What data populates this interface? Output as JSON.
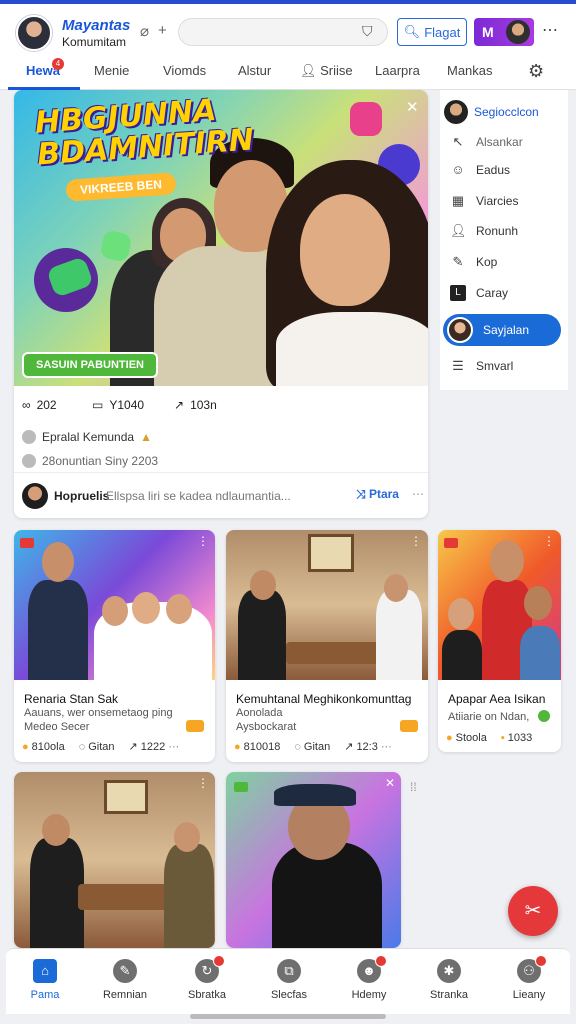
{
  "header": {
    "brand_title": "Mayantas",
    "brand_subtitle": "Komumitam",
    "search_placeholder": "",
    "flag_label": "Flagat",
    "m_label": "M"
  },
  "tabs": [
    {
      "label": "Hewa",
      "active": true,
      "badge": "4"
    },
    {
      "label": "Menie"
    },
    {
      "label": "Viomds"
    },
    {
      "label": "Alstur"
    },
    {
      "label": "Sriise"
    },
    {
      "label": "Laarpra"
    },
    {
      "label": "Mankas"
    }
  ],
  "hero": {
    "title_line1": "HBGJUNNA",
    "title_line2": "BDAMNITIRN",
    "subtitle": "VIKREEB BEN",
    "pill": "SASUIN PABUNTIEN",
    "stats": {
      "likes": "202",
      "comments": "Y1040",
      "shares": "103n"
    },
    "meta_title": "Epralal Kemunda",
    "meta_sub": "28onuntian Siny 2203",
    "footer_name": "Hopruelis",
    "footer_text": "Ellspsa liri se kadea ndlaumantia...",
    "footer_share": "Ptara"
  },
  "sidebar": {
    "header": "Segiocclcon",
    "items": [
      {
        "label": "Alsankar",
        "icon": "back-arrow-icon"
      },
      {
        "label": "Eadus",
        "icon": "smiley-icon"
      },
      {
        "label": "Viarcies",
        "icon": "calendar-icon"
      },
      {
        "label": "Ronunh",
        "icon": "person-icon"
      },
      {
        "label": "Kop",
        "icon": "edit-icon"
      },
      {
        "label": "Caray",
        "icon": "l-square-icon"
      },
      {
        "label": "Sayjalan",
        "icon": "avatar",
        "active": true
      },
      {
        "label": "Smvarl",
        "icon": "menu-icon"
      }
    ]
  },
  "cards": [
    {
      "title": "Renaria Stan Sak",
      "desc1": "Aauans, wer onsemetaog ping",
      "desc2": "Medeo Secer",
      "stat1": "810ola",
      "stat2": "Gitan",
      "stat3": "1222"
    },
    {
      "title": "Kemuhtanal Meghikonkomunttag",
      "desc1": "Aonolada",
      "desc2": "Aysbockarat",
      "stat1": "810018",
      "stat2": "Gitan",
      "stat3": "12:3"
    },
    {
      "title": "Apapar Aea Isikan",
      "desc1": "Atiiarie on Ndan,",
      "stat1": "Stoola",
      "stat2": "1033"
    },
    {
      "title": "",
      "desc1": ""
    },
    {
      "title": "",
      "desc1": ""
    }
  ],
  "bottom_nav": [
    {
      "label": "Pama",
      "active": true
    },
    {
      "label": "Remnian"
    },
    {
      "label": "Sbratka"
    },
    {
      "label": "Slecfas"
    },
    {
      "label": "Hdemy"
    },
    {
      "label": "Stranka"
    },
    {
      "label": "Lieany"
    }
  ],
  "colors": {
    "accent": "#1a57d8",
    "fab": "#e5383b",
    "badge": "#e53935"
  }
}
